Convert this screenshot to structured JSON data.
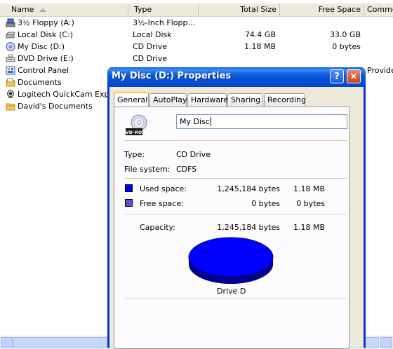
{
  "explorer": {
    "columns": {
      "name": "Name",
      "type": "Type",
      "total_size": "Total Size",
      "free_space": "Free Space",
      "comments": "Comme"
    },
    "rows": [
      {
        "name": "3½ Floppy (A:)",
        "type": "3½-Inch Flopp…",
        "total": "",
        "free": "",
        "icon": "floppy-drive-icon"
      },
      {
        "name": "Local Disk (C:)",
        "type": "Local Disk",
        "total": "74.4 GB",
        "free": "33.0 GB",
        "icon": "hard-disk-icon"
      },
      {
        "name": "My Disc (D:)",
        "type": "CD Drive",
        "total": "1.18 MB",
        "free": "0 bytes",
        "icon": "cd-drive-icon"
      },
      {
        "name": "DVD Drive (E:)",
        "type": "CD Drive",
        "total": "",
        "free": "",
        "icon": "dvd-drive-icon"
      },
      {
        "name": "Control Panel",
        "type": "",
        "total": "",
        "free": "",
        "icon": "control-panel-icon"
      },
      {
        "name": "Documents",
        "type": "",
        "total": "",
        "free": "",
        "icon": "folder-icon"
      },
      {
        "name": "Logitech QuickCam Expres",
        "type": "",
        "total": "",
        "free": "",
        "icon": "webcam-icon"
      },
      {
        "name": "David's Documents",
        "type": "",
        "total": "",
        "free": "",
        "icon": "folder-icon"
      }
    ],
    "control_panel_comment": "Provide"
  },
  "dialog": {
    "title": "My Disc (D:) Properties",
    "help_label": "?",
    "close_label": "×",
    "tabs": [
      "General",
      "AutoPlay",
      "Hardware",
      "Sharing",
      "Recording"
    ],
    "active_tab": "General",
    "drive_icon_label": "DVD-ROM",
    "name_value": "My Disc",
    "type_label": "Type:",
    "type_value": "CD Drive",
    "fs_label": "File system:",
    "fs_value": "CDFS",
    "used_label": "Used space:",
    "used_bytes": "1,245,184 bytes",
    "used_size": "1.18 MB",
    "free_label": "Free space:",
    "free_bytes": "0 bytes",
    "free_size": "0 bytes",
    "capacity_label": "Capacity:",
    "capacity_bytes": "1,245,184 bytes",
    "capacity_size": "1.18 MB",
    "drive_caption": "Drive D",
    "colors": {
      "used": "#0000ff",
      "free": "#5454d4",
      "title_bar": "#0a5fd7"
    }
  }
}
